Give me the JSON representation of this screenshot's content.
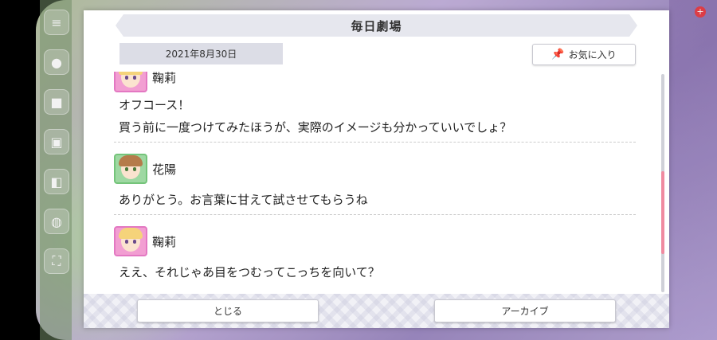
{
  "dialog": {
    "title": "毎日劇場",
    "date": "2021年8月30日",
    "favorite_label": "お気に入り",
    "close_label": "とじる",
    "archive_label": "アーカイブ"
  },
  "entries": [
    {
      "speaker": "鞠莉",
      "lines": [
        "オフコース！",
        "買う前に一度つけてみたほうが、実際のイメージも分かっていいでしょ？"
      ]
    },
    {
      "speaker": "花陽",
      "lines": [
        "ありがとう。お言葉に甘えて試させてもらうね"
      ]
    },
    {
      "speaker": "鞠莉",
      "lines": [
        "ええ、それじゃあ目をつむってこっちを向いて？"
      ]
    }
  ],
  "scroll": {
    "position": 0.72,
    "visible_fraction": 0.38
  },
  "colors": {
    "accent_pink": "#f08aa0",
    "avatar_pink": "#f29ed2",
    "avatar_green": "#9ed8a2"
  },
  "icons": [
    "pin-icon",
    "menu-icon",
    "plus-icon"
  ]
}
